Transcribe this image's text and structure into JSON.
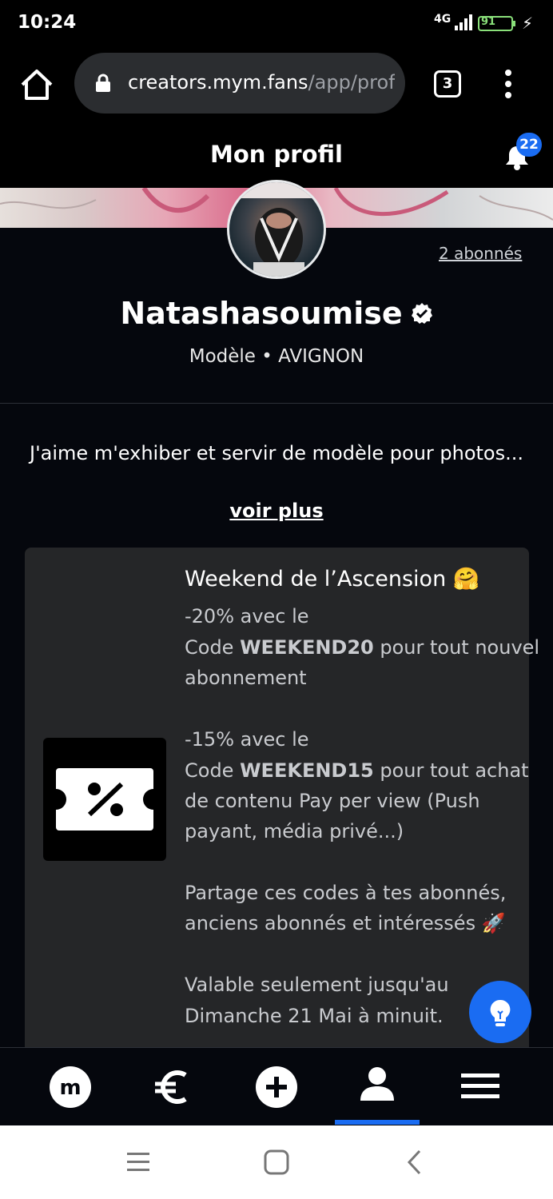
{
  "status_bar": {
    "time": "10:24",
    "network": "4G",
    "battery": "91"
  },
  "browser": {
    "url_host": "creators.mym.fans",
    "url_path": "/app/profi",
    "tab_count": "3",
    "icons": [
      "home-icon",
      "lock-icon",
      "tabs-icon",
      "more-vert-icon"
    ]
  },
  "header": {
    "title": "Mon profil",
    "notification_count": "22"
  },
  "profile": {
    "subscribers": "2 abonnés",
    "name": "Natashasoumise",
    "subtitle": "Modèle • AVIGNON",
    "bio": "J'aime m'exhiber et servir de modèle pour photos...",
    "see_more": "voir plus"
  },
  "promo": {
    "title": "Weekend de l’Ascension 🤗",
    "line1": "-20% avec le",
    "line2_pre": "Code ",
    "line2_code": "WEEKEND20",
    "line2_post": " pour tout nouvel",
    "line3": "abonnement",
    "line4": "-15% avec le",
    "line5_pre": "Code ",
    "line5_code": "WEEKEND15",
    "line5_post": " pour tout achat",
    "line6": "de contenu Pay per view (Push",
    "line7": "payant, média privé...)",
    "line8": "Partage ces codes à tes abonnés,",
    "line9": "anciens abonnés et intéressés 🚀",
    "line10": "Valable seulement jusqu'au",
    "line11": "Dimanche 21 Mai à minuit."
  },
  "bottom_nav": {
    "items": [
      "mym-logo-icon",
      "euro-icon",
      "add-icon",
      "profile-icon",
      "menu-icon"
    ],
    "active": "profile-icon"
  },
  "colors": {
    "accent": "#1a6cf2",
    "background": "#05070d",
    "card": "#252628"
  }
}
